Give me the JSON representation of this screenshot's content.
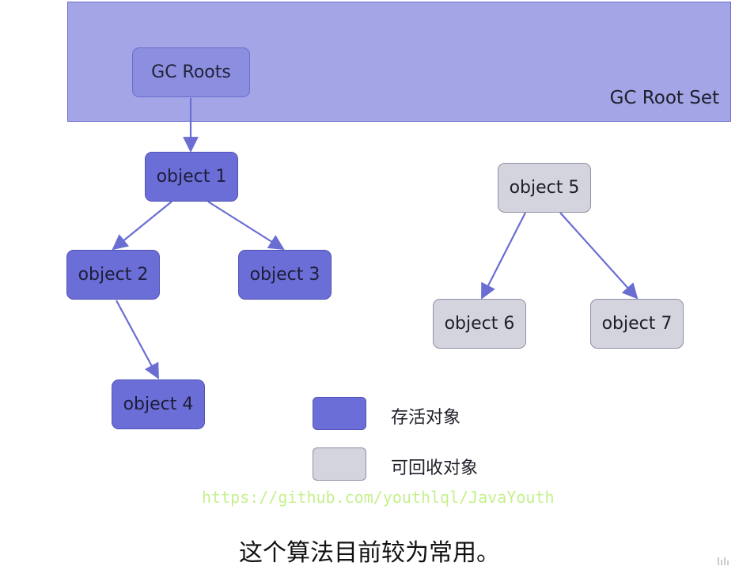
{
  "root_set": {
    "label": "GC Root Set"
  },
  "nodes": {
    "gc_roots": "GC Roots",
    "object1": "object 1",
    "object2": "object 2",
    "object3": "object 3",
    "object4": "object 4",
    "object5": "object 5",
    "object6": "object 6",
    "object7": "object 7"
  },
  "legend": {
    "live": "存活对象",
    "collectable": "可回收对象"
  },
  "watermark_url": "https://github.com/youthlql/JavaYouth",
  "caption": "这个算法目前较为常用。",
  "colors": {
    "root_set_fill": "#a3a5e6",
    "live_fill": "#6b6ed6",
    "collectable_fill": "#d4d4df",
    "edge": "#6a6dd2"
  }
}
